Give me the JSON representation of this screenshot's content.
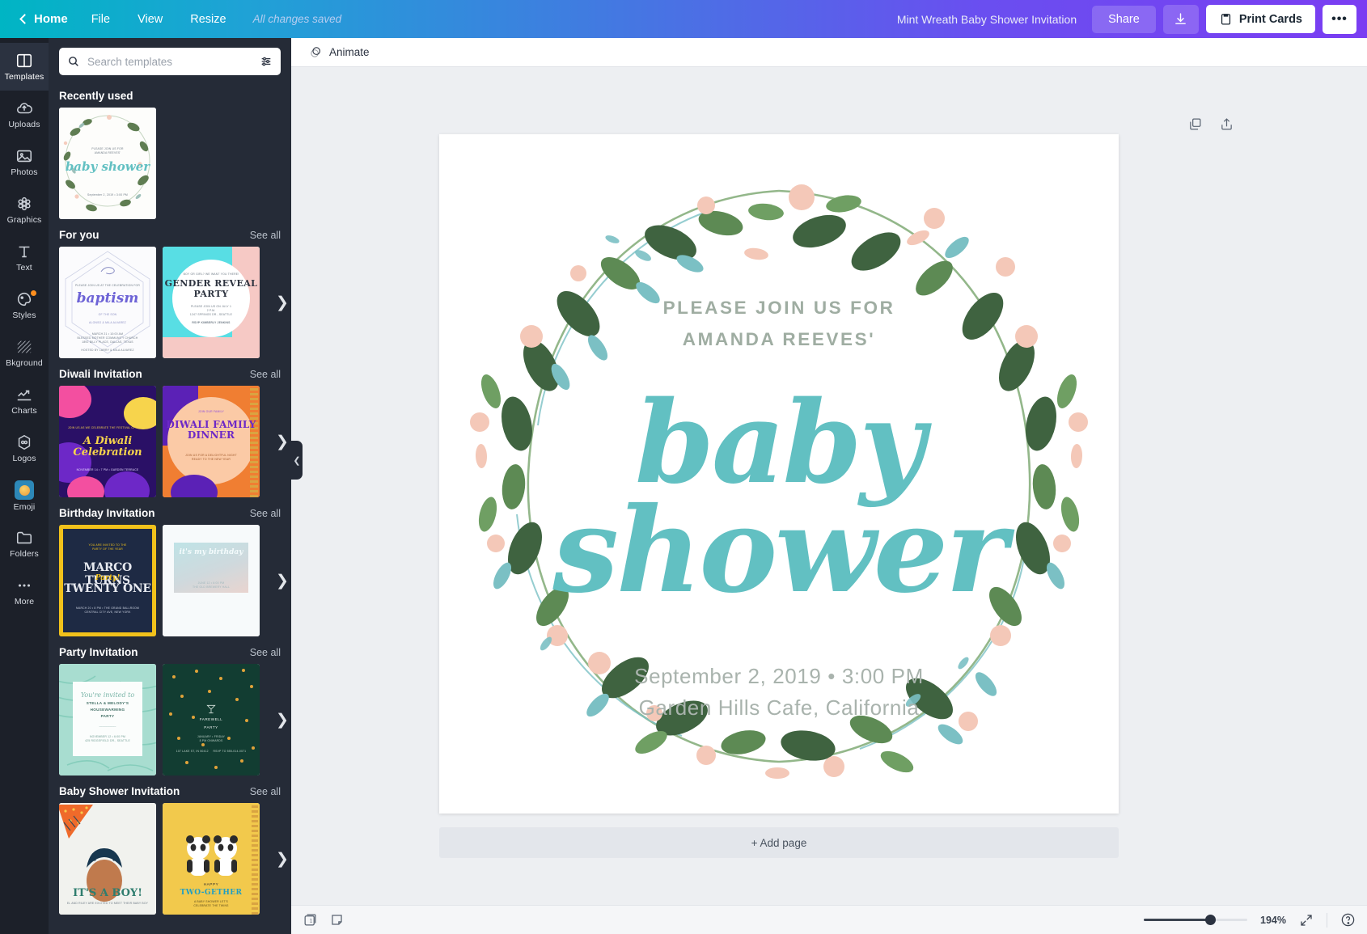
{
  "topbar": {
    "home": "Home",
    "menu": [
      "File",
      "View",
      "Resize"
    ],
    "saved_status": "All changes saved",
    "doc_title": "Mint Wreath Baby Shower Invitation",
    "share": "Share",
    "download_icon": "download-icon",
    "print": "Print Cards",
    "more": "•••"
  },
  "rail": {
    "items": [
      {
        "label": "Templates",
        "icon": "templates-icon",
        "active": true,
        "badge": false
      },
      {
        "label": "Uploads",
        "icon": "upload-cloud-icon",
        "active": false,
        "badge": false
      },
      {
        "label": "Photos",
        "icon": "photo-icon",
        "active": false,
        "badge": false
      },
      {
        "label": "Graphics",
        "icon": "graphics-icon",
        "active": false,
        "badge": false
      },
      {
        "label": "Text",
        "icon": "text-icon",
        "active": false,
        "badge": false
      },
      {
        "label": "Styles",
        "icon": "styles-palette-icon",
        "active": false,
        "badge": true
      },
      {
        "label": "Bkground",
        "icon": "background-icon",
        "active": false,
        "badge": false
      },
      {
        "label": "Charts",
        "icon": "charts-icon",
        "active": false,
        "badge": false
      },
      {
        "label": "Logos",
        "icon": "logos-icon",
        "active": false,
        "badge": false
      },
      {
        "label": "Emoji",
        "icon": "emoji-icon",
        "active": false,
        "badge": false
      },
      {
        "label": "Folders",
        "icon": "folder-icon",
        "active": false,
        "badge": false
      },
      {
        "label": "More",
        "icon": "more-dots-icon",
        "active": false,
        "badge": false
      }
    ]
  },
  "panel": {
    "search_placeholder": "Search templates",
    "search_value": "",
    "filter_icon": "filter-sliders-icon",
    "see_all": "See all",
    "sections": [
      {
        "title": "Recently used",
        "has_see_all": false
      },
      {
        "title": "For you",
        "has_see_all": true
      },
      {
        "title": "Diwali Invitation",
        "has_see_all": true
      },
      {
        "title": "Birthday Invitation",
        "has_see_all": true
      },
      {
        "title": "Party Invitation",
        "has_see_all": true
      },
      {
        "title": "Baby Shower Invitation",
        "has_see_all": true
      }
    ],
    "templates": {
      "recent_1": "baby shower",
      "foryou_1": "baptism",
      "foryou_2": "GENDER REVEAL PARTY",
      "diwali_1": "A Diwali Celebration",
      "diwali_2": "DIWALI FAMILY DINNER",
      "birthday_1_l1": "MARCO TURNS",
      "birthday_1_l2": "TWENTY ONE",
      "birthday_1_script": "Party!",
      "birthday_2": "it's my birthday",
      "party_1_l1": "STELLA & MELODY'S",
      "party_1_l2": "HOUSEWARMING",
      "party_1_l3": "PARTY",
      "party_1_script": "You're invited to",
      "party_2_l1": "FAREWELL",
      "party_2_l2": "PARTY",
      "baby_1": "IT'S A BOY!",
      "baby_2_l1": "HAPPY",
      "baby_2_l2": "TWO-GETHER"
    }
  },
  "editor": {
    "animate": "Animate",
    "animate_icon": "animate-icon",
    "copy_page_icon": "duplicate-page-icon",
    "export_page_icon": "share-page-icon",
    "add_page": "+ Add page",
    "collapse_icon": "collapse-panel-chevron"
  },
  "invitation": {
    "line1": "PLEASE JOIN US FOR",
    "line2": "AMANDA REEVES'",
    "script1": "baby",
    "script2": "shower",
    "date": "September 2, 2019  •  3:00 PM",
    "place": "Garden Hills Cafe, California",
    "accent_color": "#62c0c2",
    "text_color": "#a9b3ad"
  },
  "bottombar": {
    "page_manager_icon": "page-manager-icon",
    "notes_icon": "notes-icon",
    "zoom_value": "194%",
    "fullscreen_icon": "fullscreen-icon",
    "help_icon": "help-question-icon"
  }
}
